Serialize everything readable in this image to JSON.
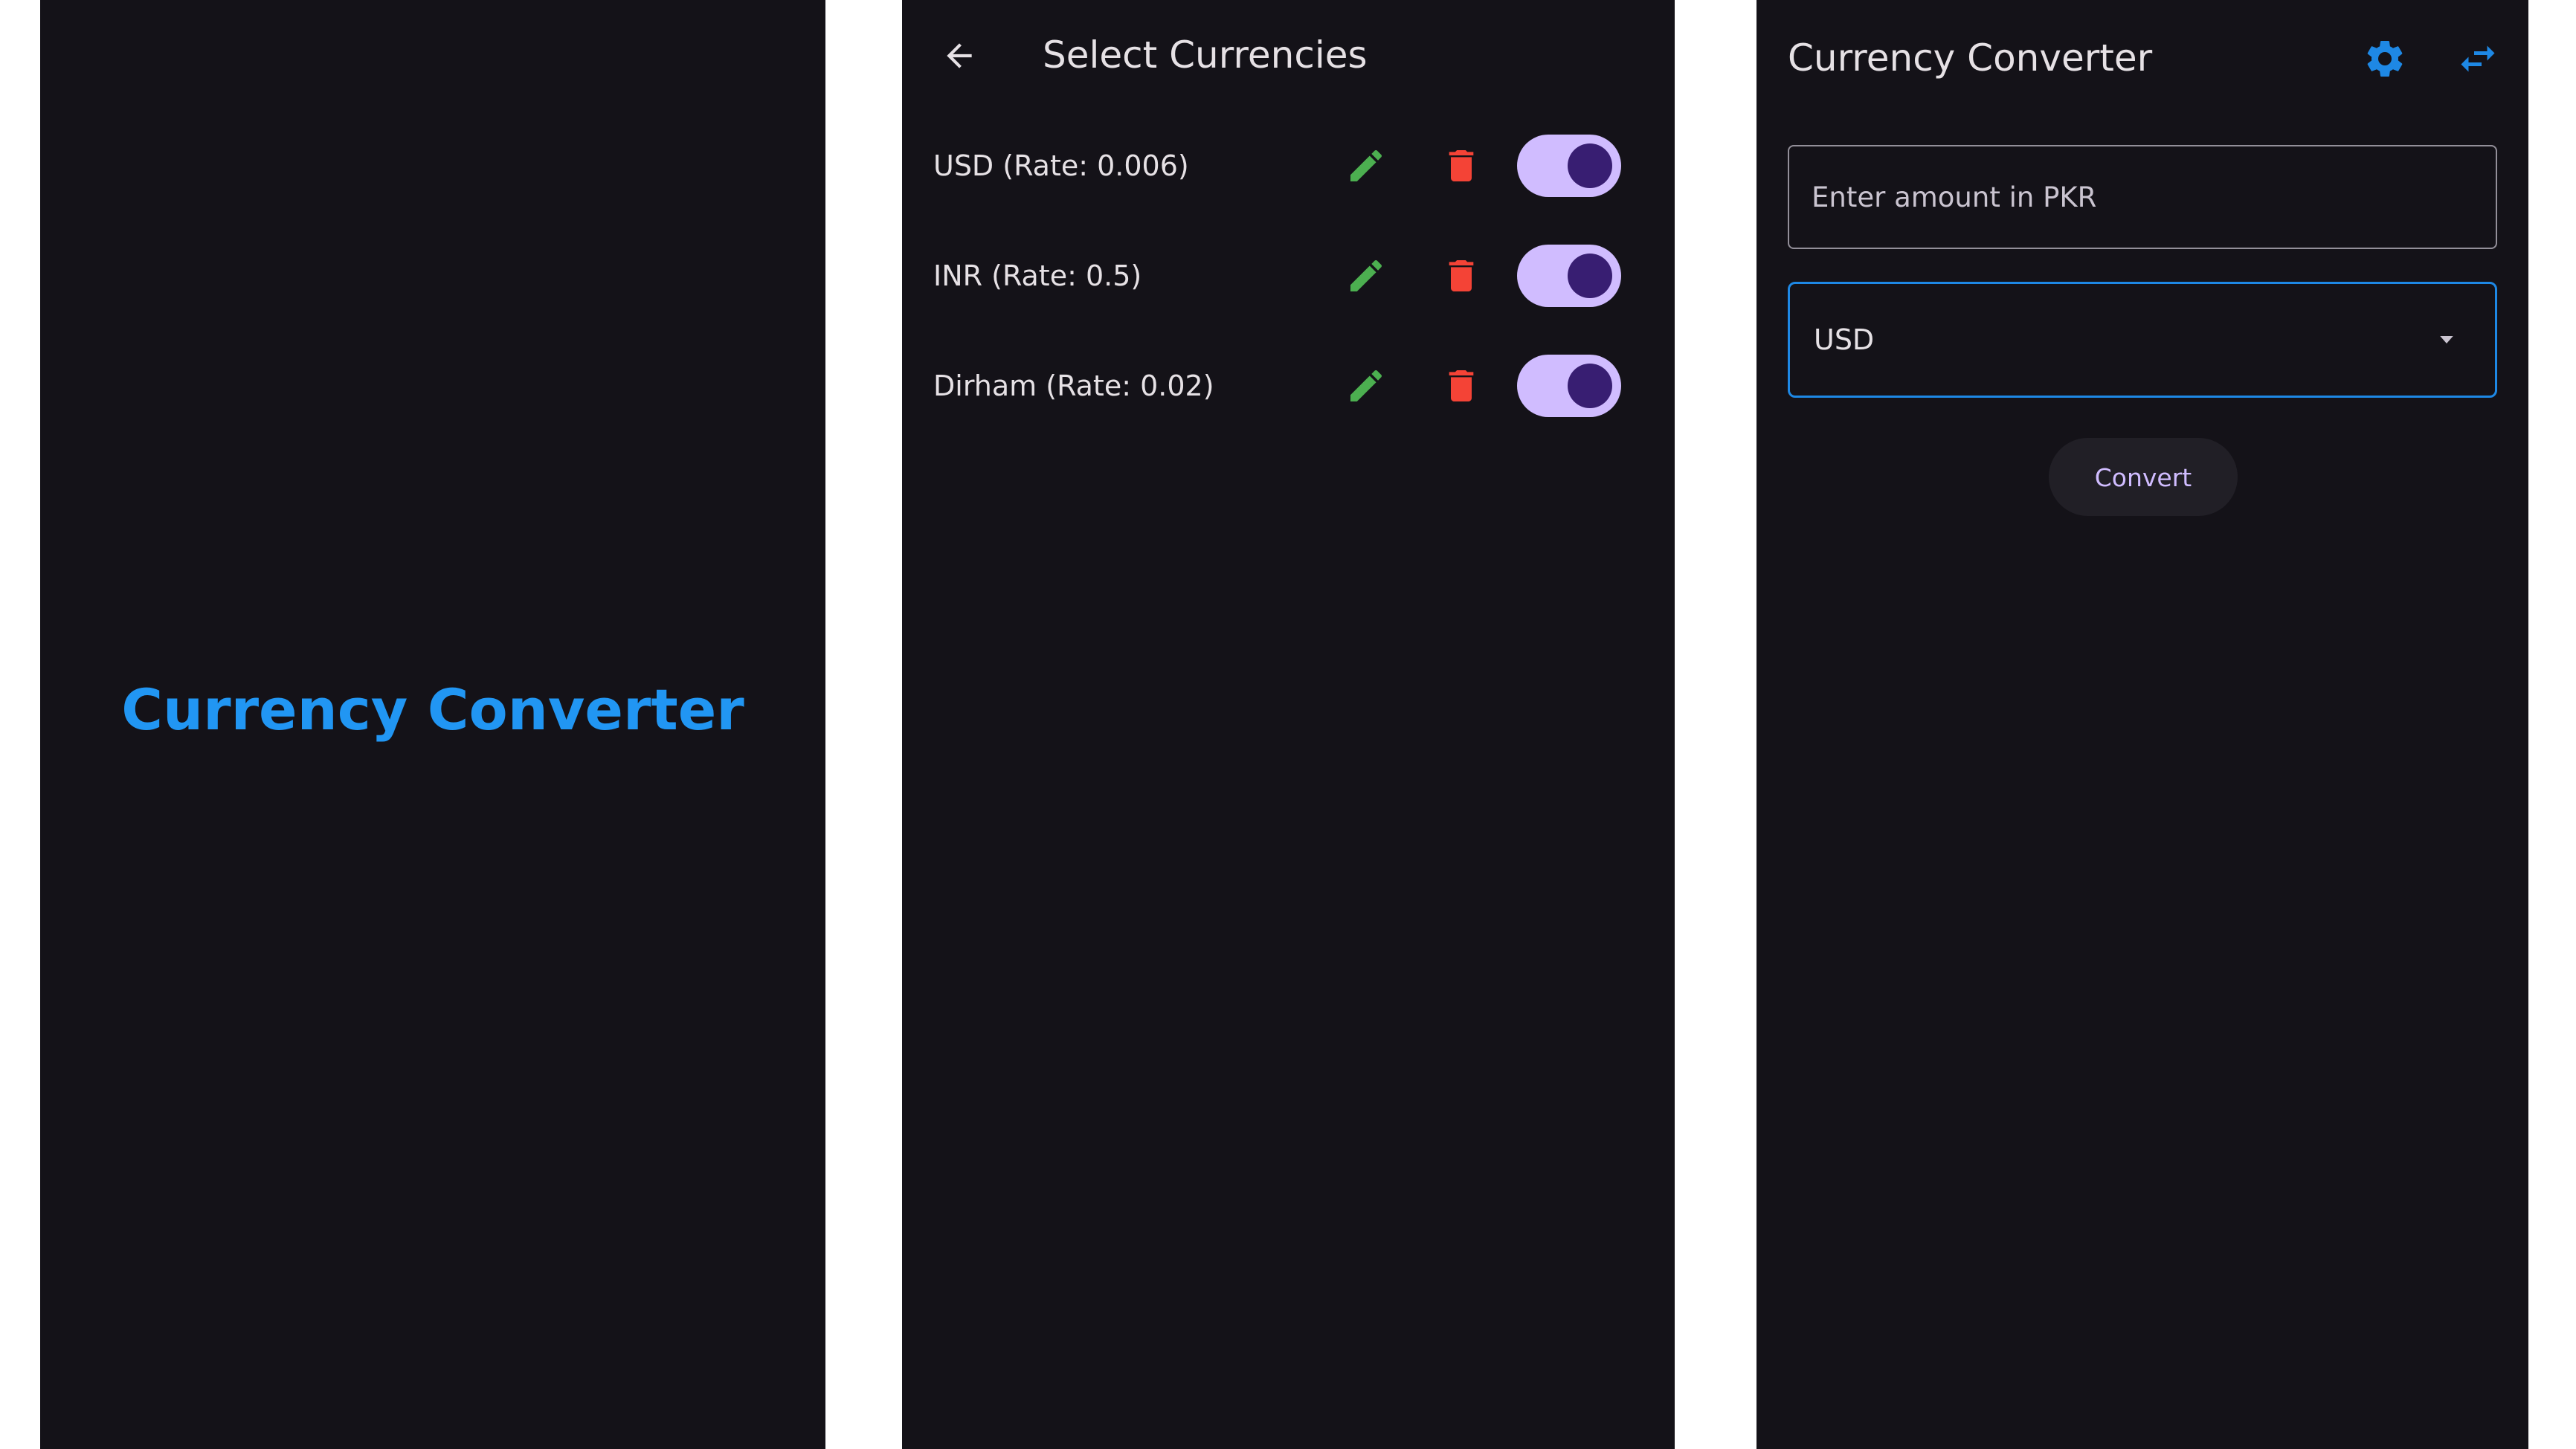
{
  "colors": {
    "background": "#141218",
    "splash_title": "#2196f3",
    "edit_icon": "#4caf50",
    "delete_icon": "#f44336",
    "toggle_track": "#d0bcff",
    "toggle_thumb": "#381e72",
    "accent_icons": "#1e88e5"
  },
  "splash": {
    "title": "Currency Converter"
  },
  "select_currencies": {
    "back_icon": "arrow-left-icon",
    "title": "Select Currencies",
    "items": [
      {
        "label": "USD (Rate: 0.006)",
        "edit_icon": "pencil-icon",
        "delete_icon": "trash-icon",
        "enabled": true
      },
      {
        "label": "INR (Rate: 0.5)",
        "edit_icon": "pencil-icon",
        "delete_icon": "trash-icon",
        "enabled": true
      },
      {
        "label": "Dirham (Rate: 0.02)",
        "edit_icon": "pencil-icon",
        "delete_icon": "trash-icon",
        "enabled": true
      }
    ]
  },
  "converter": {
    "title": "Currency Converter",
    "settings_icon": "gear-icon",
    "swap_icon": "swap-icon",
    "amount_placeholder": "Enter amount in PKR",
    "amount_value": "",
    "currency_selected": "USD",
    "dropdown_icon": "caret-down-icon",
    "convert_label": "Convert"
  }
}
